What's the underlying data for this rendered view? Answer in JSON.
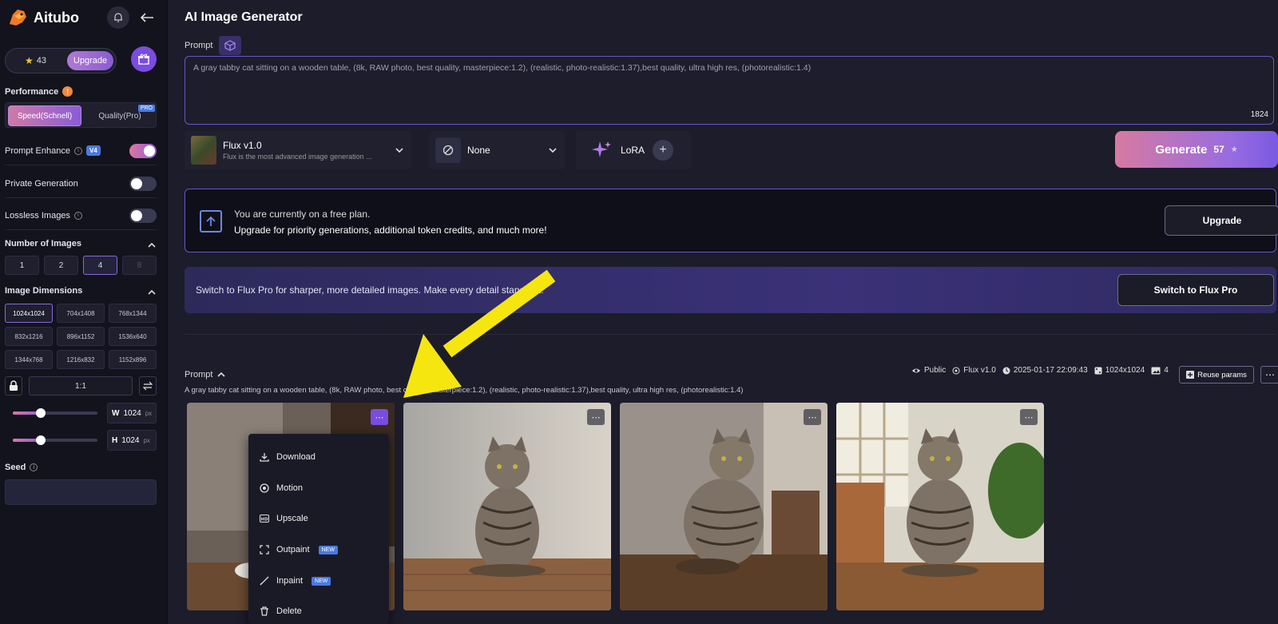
{
  "app": {
    "name": "Aitubo"
  },
  "sidebar": {
    "credits": "43",
    "upgrade_label": "Upgrade",
    "performance": {
      "label": "Performance",
      "speed": "Speed(Schnell)",
      "quality": "Quality(Pro)",
      "pro_badge": "PRO"
    },
    "prompt_enhance": {
      "label": "Prompt Enhance",
      "badge": "V4",
      "on": true
    },
    "private_generation": {
      "label": "Private Generation",
      "on": false
    },
    "lossless_images": {
      "label": "Lossless Images",
      "on": false
    },
    "number_of_images": {
      "label": "Number of Images",
      "options": [
        "1",
        "2",
        "4",
        "8"
      ],
      "selected": "4"
    },
    "image_dimensions": {
      "label": "Image Dimensions",
      "options": [
        "1024x1024",
        "704x1408",
        "768x1344",
        "832x1216",
        "896x1152",
        "1536x640",
        "1344x768",
        "1216x832",
        "1152x896"
      ],
      "selected": "1024x1024",
      "ratio": "1:1",
      "width": {
        "key": "W",
        "value": "1024",
        "unit": "px"
      },
      "height": {
        "key": "H",
        "value": "1024",
        "unit": "px"
      }
    },
    "seed": {
      "label": "Seed",
      "value": ""
    }
  },
  "main": {
    "title": "AI Image Generator",
    "prompt_label": "Prompt",
    "prompt_value": "A gray tabby cat sitting on a wooden table, (8k, RAW photo, best quality, masterpiece:1.2), (realistic, photo-realistic:1.37),best quality, ultra high res, (photorealistic:1.4)",
    "prompt_count": "1824",
    "model": {
      "name": "Flux v1.0",
      "desc": "Flux is the most advanced image generation ..."
    },
    "style": {
      "name": "None"
    },
    "lora": {
      "name": "LoRA"
    },
    "generate": {
      "label": "Generate",
      "cost": "57"
    },
    "free_banner": {
      "line1": "You are currently on a free plan.",
      "line2": "Upgrade for priority generations, additional token credits, and much more!",
      "button": "Upgrade"
    },
    "pro_banner": {
      "text": "Switch to Flux Pro for sharper, more detailed images. Make every detail stand out!",
      "button": "Switch to Flux Pro"
    }
  },
  "history": {
    "prompt_label": "Prompt",
    "prompt_text": "A gray tabby cat sitting on a wooden table, (8k, RAW photo, best quality, masterpiece:1.2), (realistic, photo-realistic:1.37),best quality, ultra high res, (photorealistic:1.4)",
    "meta": {
      "visibility": "Public",
      "model": "Flux v1.0",
      "datetime": "2025-01-17 22:09:43",
      "size": "1024x1024",
      "count": "4"
    },
    "reuse_label": "Reuse params",
    "menu": [
      {
        "label": "Download",
        "icon": "download-icon"
      },
      {
        "label": "Motion",
        "icon": "motion-icon"
      },
      {
        "label": "Upscale",
        "icon": "hd-icon"
      },
      {
        "label": "Outpaint",
        "icon": "expand-icon",
        "tag": "NEW"
      },
      {
        "label": "Inpaint",
        "icon": "brush-icon",
        "tag": "NEW"
      },
      {
        "label": "Delete",
        "icon": "trash-icon"
      }
    ]
  },
  "colors": {
    "accent": "#7b4ce0",
    "gradient_start": "#d77aa0",
    "annotation_arrow": "#f5e60f"
  }
}
